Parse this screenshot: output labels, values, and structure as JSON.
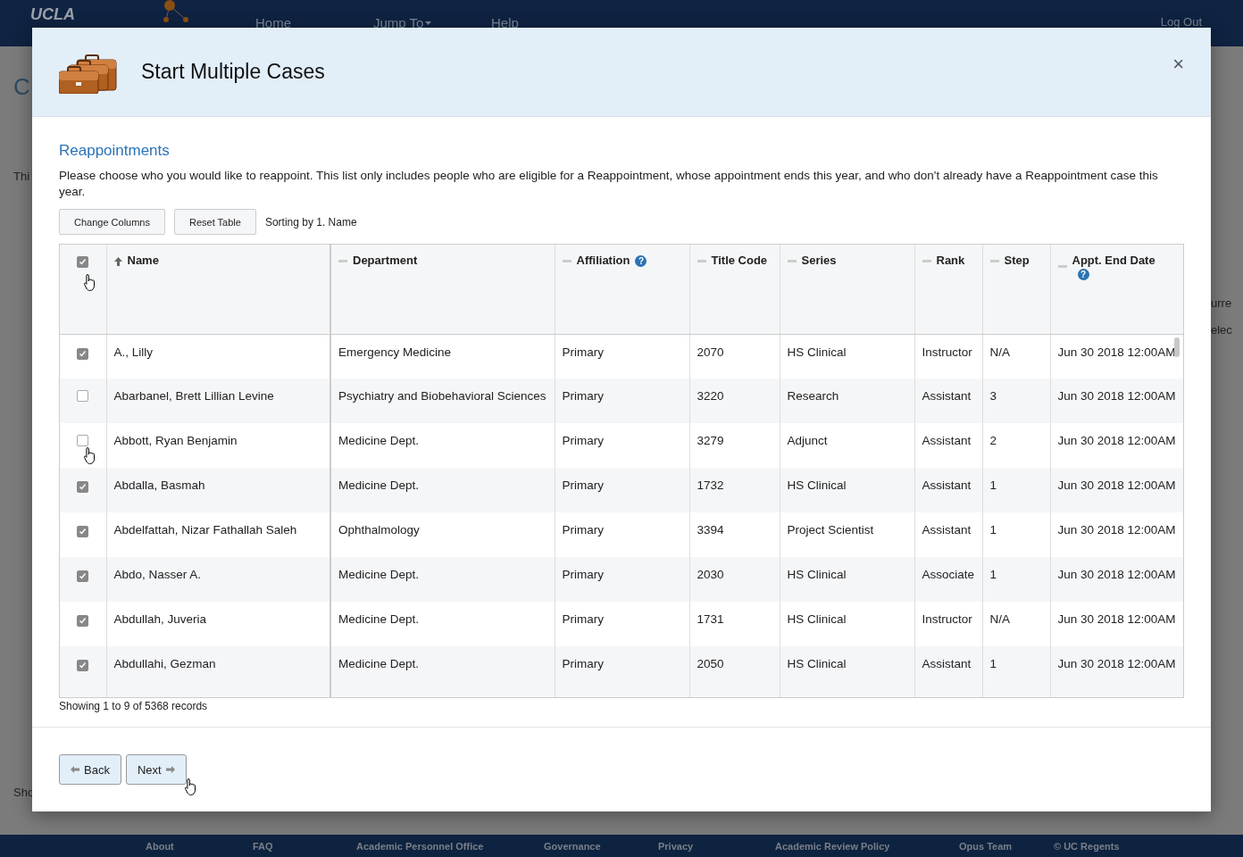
{
  "nav": {
    "brand_top": "UCLA",
    "links": [
      "Home",
      "Jump To",
      "Help"
    ],
    "logout": "Log Out"
  },
  "backdrop": {
    "heading": "C",
    "intro": "Thi",
    "footer_note": "Sho",
    "right_header": "urre",
    "right_cell": "elec"
  },
  "modal": {
    "title": "Start Multiple Cases",
    "close": "×",
    "section_title": "Reappointments",
    "description": "Please choose who you would like to reappoint. This list only includes people who are eligible for a Reappointment, whose appointment ends this year, and who don't already have a Reappointment case this year.",
    "toolbar": {
      "buttons": [
        "Change Columns",
        "Reset Table"
      ],
      "sorting": "Sorting by 1. Name"
    },
    "table": {
      "select_all": {
        "checked": true
      },
      "columns": [
        {
          "label": "Name",
          "sorted": true
        },
        {
          "label": "Department",
          "sorted": false
        },
        {
          "label": "Affiliation",
          "sorted": false,
          "help": "?"
        },
        {
          "label": "Title Code",
          "sorted": false
        },
        {
          "label": "Series",
          "sorted": false
        },
        {
          "label": "Rank",
          "sorted": false
        },
        {
          "label": "Step",
          "sorted": false
        },
        {
          "label": "Appt. End Date",
          "sorted": false,
          "help": "?"
        }
      ],
      "rows": [
        {
          "checked": true,
          "cells": [
            "A., Lilly",
            "Emergency Medicine",
            "Primary",
            "2070",
            "HS Clinical",
            "Instructor",
            "N/A",
            "Jun 30 2018 12:00AM"
          ]
        },
        {
          "checked": false,
          "cells": [
            "Abarbanel, Brett Lillian Levine",
            "Psychiatry and Biobehavioral Sciences",
            "Primary",
            "3220",
            "Research",
            "Assistant",
            "3",
            "Jun 30 2018 12:00AM"
          ]
        },
        {
          "checked": false,
          "cells": [
            "Abbott, Ryan Benjamin",
            "Medicine Dept.",
            "Primary",
            "3279",
            "Adjunct",
            "Assistant",
            "2",
            "Jun 30 2018 12:00AM"
          ]
        },
        {
          "checked": true,
          "cells": [
            "Abdalla, Basmah",
            "Medicine Dept.",
            "Primary",
            "1732",
            "HS Clinical",
            "Assistant",
            "1",
            "Jun 30 2018 12:00AM"
          ]
        },
        {
          "checked": true,
          "cells": [
            "Abdelfattah, Nizar Fathallah Saleh",
            "Ophthalmology",
            "Primary",
            "3394",
            "Project Scientist",
            "Assistant",
            "1",
            "Jun 30 2018 12:00AM"
          ]
        },
        {
          "checked": true,
          "cells": [
            "Abdo, Nasser A.",
            "Medicine Dept.",
            "Primary",
            "2030",
            "HS Clinical",
            "Associate",
            "1",
            "Jun 30 2018 12:00AM"
          ]
        },
        {
          "checked": true,
          "cells": [
            "Abdullah, Juveria",
            "Medicine Dept.",
            "Primary",
            "1731",
            "HS Clinical",
            "Instructor",
            "N/A",
            "Jun 30 2018 12:00AM"
          ]
        },
        {
          "checked": true,
          "cells": [
            "Abdullahi, Gezman",
            "Medicine Dept.",
            "Primary",
            "2050",
            "HS Clinical",
            "Assistant",
            "1",
            "Jun 30 2018 12:00AM"
          ]
        }
      ]
    },
    "records": "Showing 1 to 9 of 5368 records",
    "back": "Back",
    "next": "Next"
  },
  "footer": [
    "About",
    "FAQ",
    "Academic Personnel Office",
    "Governance",
    "Privacy",
    "Academic Review Policy",
    "Opus Team",
    "© UC Regents"
  ]
}
